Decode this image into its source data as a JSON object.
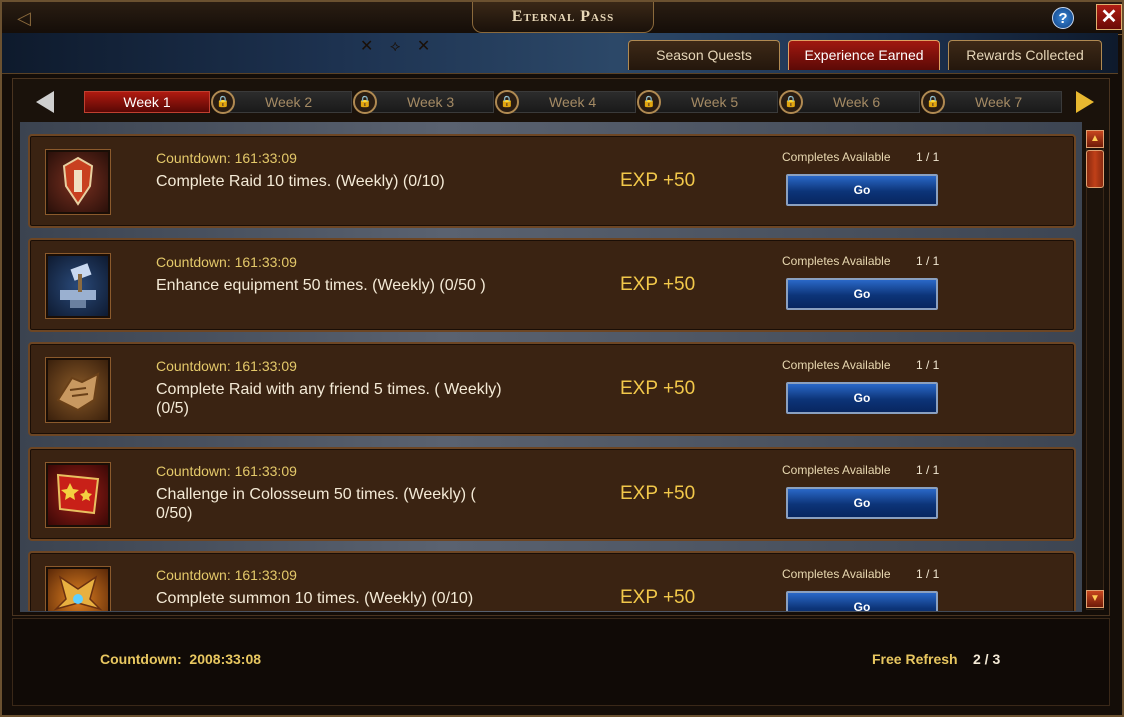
{
  "window": {
    "title": "Eternal Pass"
  },
  "tabs": [
    {
      "label": "Season Quests",
      "active": false
    },
    {
      "label": "Experience Earned",
      "active": true
    },
    {
      "label": "Rewards Collected",
      "active": false
    }
  ],
  "weeks": [
    {
      "label": "Week 1",
      "active": true,
      "locked": false
    },
    {
      "label": "Week 2",
      "active": false,
      "locked": true
    },
    {
      "label": "Week 3",
      "active": false,
      "locked": true
    },
    {
      "label": "Week 4",
      "active": false,
      "locked": true
    },
    {
      "label": "Week 5",
      "active": false,
      "locked": true
    },
    {
      "label": "Week 6",
      "active": false,
      "locked": true
    },
    {
      "label": "Week 7",
      "active": false,
      "locked": true
    }
  ],
  "quests": [
    {
      "icon": "raid-helmet-icon",
      "countdown": "Countdown: 161:33:09",
      "desc": "Complete Raid 10 times. (Weekly) (0/10)",
      "exp": "EXP +50",
      "avail_label": "Completes Available",
      "avail_value": "1 / 1",
      "button": "Go"
    },
    {
      "icon": "anvil-hammer-icon",
      "countdown": "Countdown: 161:33:09",
      "desc": "Enhance equipment 50 times. (Weekly) (0/50 )",
      "exp": "EXP +50",
      "avail_label": "Completes Available",
      "avail_value": "1 / 1",
      "button": "Go"
    },
    {
      "icon": "handshake-icon",
      "countdown": "Countdown: 161:33:09",
      "desc": "Complete Raid with any friend 5 times. ( Weekly) (0/5)",
      "exp": "EXP +50",
      "avail_label": "Completes Available",
      "avail_value": "1 / 1",
      "button": "Go"
    },
    {
      "icon": "flag-stars-icon",
      "countdown": "Countdown: 161:33:09",
      "desc": "Challenge in Colosseum 50 times. (Weekly) ( 0/50)",
      "exp": "EXP +50",
      "avail_label": "Completes Available",
      "avail_value": "1 / 1",
      "button": "Go"
    },
    {
      "icon": "summon-wings-icon",
      "countdown": "Countdown: 161:33:09",
      "desc": "Complete summon 10 times. (Weekly) (0/10)",
      "exp": "EXP +50",
      "avail_label": "Completes Available",
      "avail_value": "1 / 1",
      "button": "Go"
    }
  ],
  "footer": {
    "countdown_label": "Countdown:",
    "countdown_value": "2008:33:08",
    "refresh_label": "Free Refresh",
    "refresh_value": "2 / 3"
  },
  "colors": {
    "accent_red": "#a01810",
    "gold_text": "#e4c96a",
    "go_blue": "#1a4fa8"
  }
}
